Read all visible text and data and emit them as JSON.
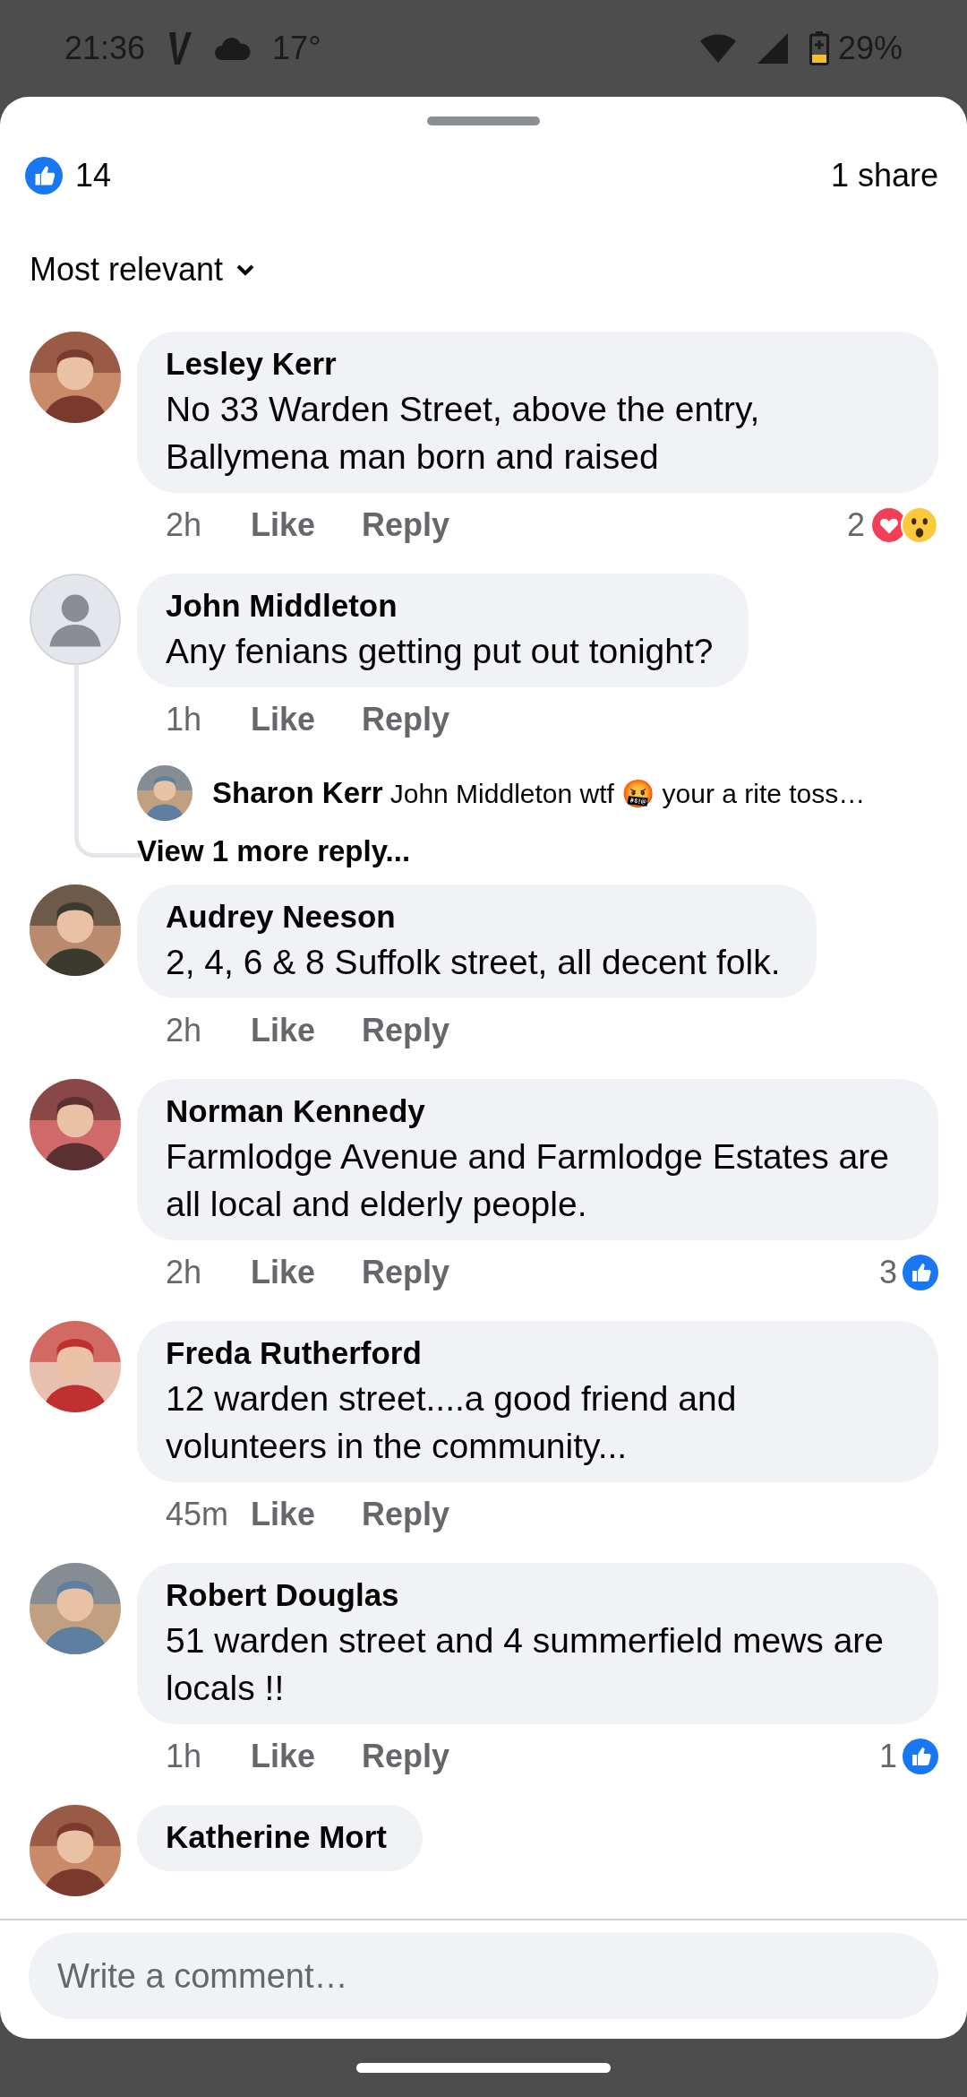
{
  "status_bar": {
    "time": "21:36",
    "temperature": "17°",
    "battery": "29%"
  },
  "header": {
    "likes": "14",
    "shares": "1 share"
  },
  "sort": {
    "label": "Most relevant"
  },
  "comments": [
    {
      "author": "Lesley Kerr",
      "text": "No 33 Warden Street, above the entry, Ballymena man born and raised",
      "time": "2h",
      "like": "Like",
      "reply": "Reply",
      "reactions": {
        "count": "2",
        "types": [
          {
            "kind": "love"
          },
          {
            "kind": "wow"
          }
        ]
      }
    },
    {
      "author": "John Middleton",
      "avatar": {
        "kind": "default"
      },
      "text": "Any fenians getting put out tonight?",
      "time": "1h",
      "like": "Like",
      "reply": "Reply",
      "replies": [
        {
          "author": "Sharon Kerr",
          "text": "John Middleton wtf 🤬 your a rite toss…"
        }
      ],
      "more_replies": "View 1 more reply..."
    },
    {
      "author": "Audrey Neeson",
      "text": "2, 4, 6 & 8 Suffolk street, all decent folk.",
      "time": "2h",
      "like": "Like",
      "reply": "Reply"
    },
    {
      "author": "Norman Kennedy",
      "text": "Farmlodge Avenue and Farmlodge Estates are all local and elderly people.",
      "time": "2h",
      "like": "Like",
      "reply": "Reply",
      "reactions": {
        "count": "3",
        "types": [
          {
            "kind": "like"
          }
        ]
      }
    },
    {
      "author": "Freda Rutherford",
      "text": "12 warden street....a good friend and volunteers in the community...",
      "time": "45m",
      "like": "Like",
      "reply": "Reply"
    },
    {
      "author": "Robert Douglas",
      "text": "51 warden street and 4 summerfield mews are locals !!",
      "time": "1h",
      "like": "Like",
      "reply": "Reply",
      "reactions": {
        "count": "1",
        "types": [
          {
            "kind": "like"
          }
        ]
      }
    },
    {
      "author": "Katherine Mort"
    }
  ],
  "composer": {
    "placeholder": "Write a comment…"
  }
}
